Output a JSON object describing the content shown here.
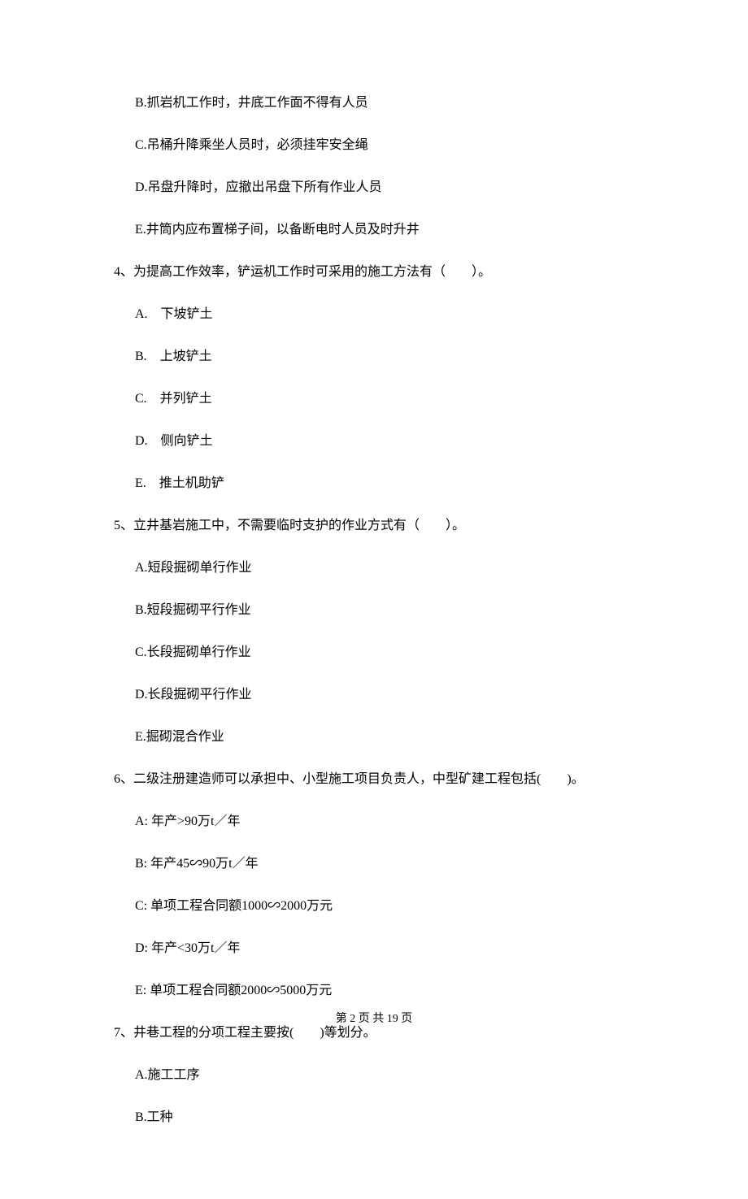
{
  "q3_options": {
    "b": "B.抓岩机工作时，井底工作面不得有人员",
    "c": "C.吊桶升降乘坐人员时，必须挂牢安全绳",
    "d": "D.吊盘升降时，应撤出吊盘下所有作业人员",
    "e": "E.井筒内应布置梯子间，以备断电时人员及时升井"
  },
  "q4": {
    "stem": "4、为提高工作效率，铲运机工作时可采用的施工方法有（　　）。",
    "a": "A.　下坡铲土",
    "b": "B.　上坡铲土",
    "c": "C.　并列铲土",
    "d": "D.　侧向铲土",
    "e": "E.　推土机助铲"
  },
  "q5": {
    "stem": "5、立井基岩施工中，不需要临时支护的作业方式有（　　）。",
    "a": "A.短段掘砌单行作业",
    "b": "B.短段掘砌平行作业",
    "c": "C.长段掘砌单行作业",
    "d": "D.长段掘砌平行作业",
    "e": "E.掘砌混合作业"
  },
  "q6": {
    "stem": "6、二级注册建造师可以承担中、小型施工项目负责人，中型矿建工程包括(　　)。",
    "a": "A:  年产>90万t／年",
    "b": "B:  年产45∽90万t／年",
    "c": "C:  单项工程合同额1000∽2000万元",
    "d": "D:  年产<30万t／年",
    "e": "E:  单项工程合同额2000∽5000万元"
  },
  "q7": {
    "stem": "7、井巷工程的分项工程主要按(　　)等划分。",
    "a": "A.施工工序",
    "b": "B.工种"
  },
  "footer": "第 2 页 共 19 页"
}
